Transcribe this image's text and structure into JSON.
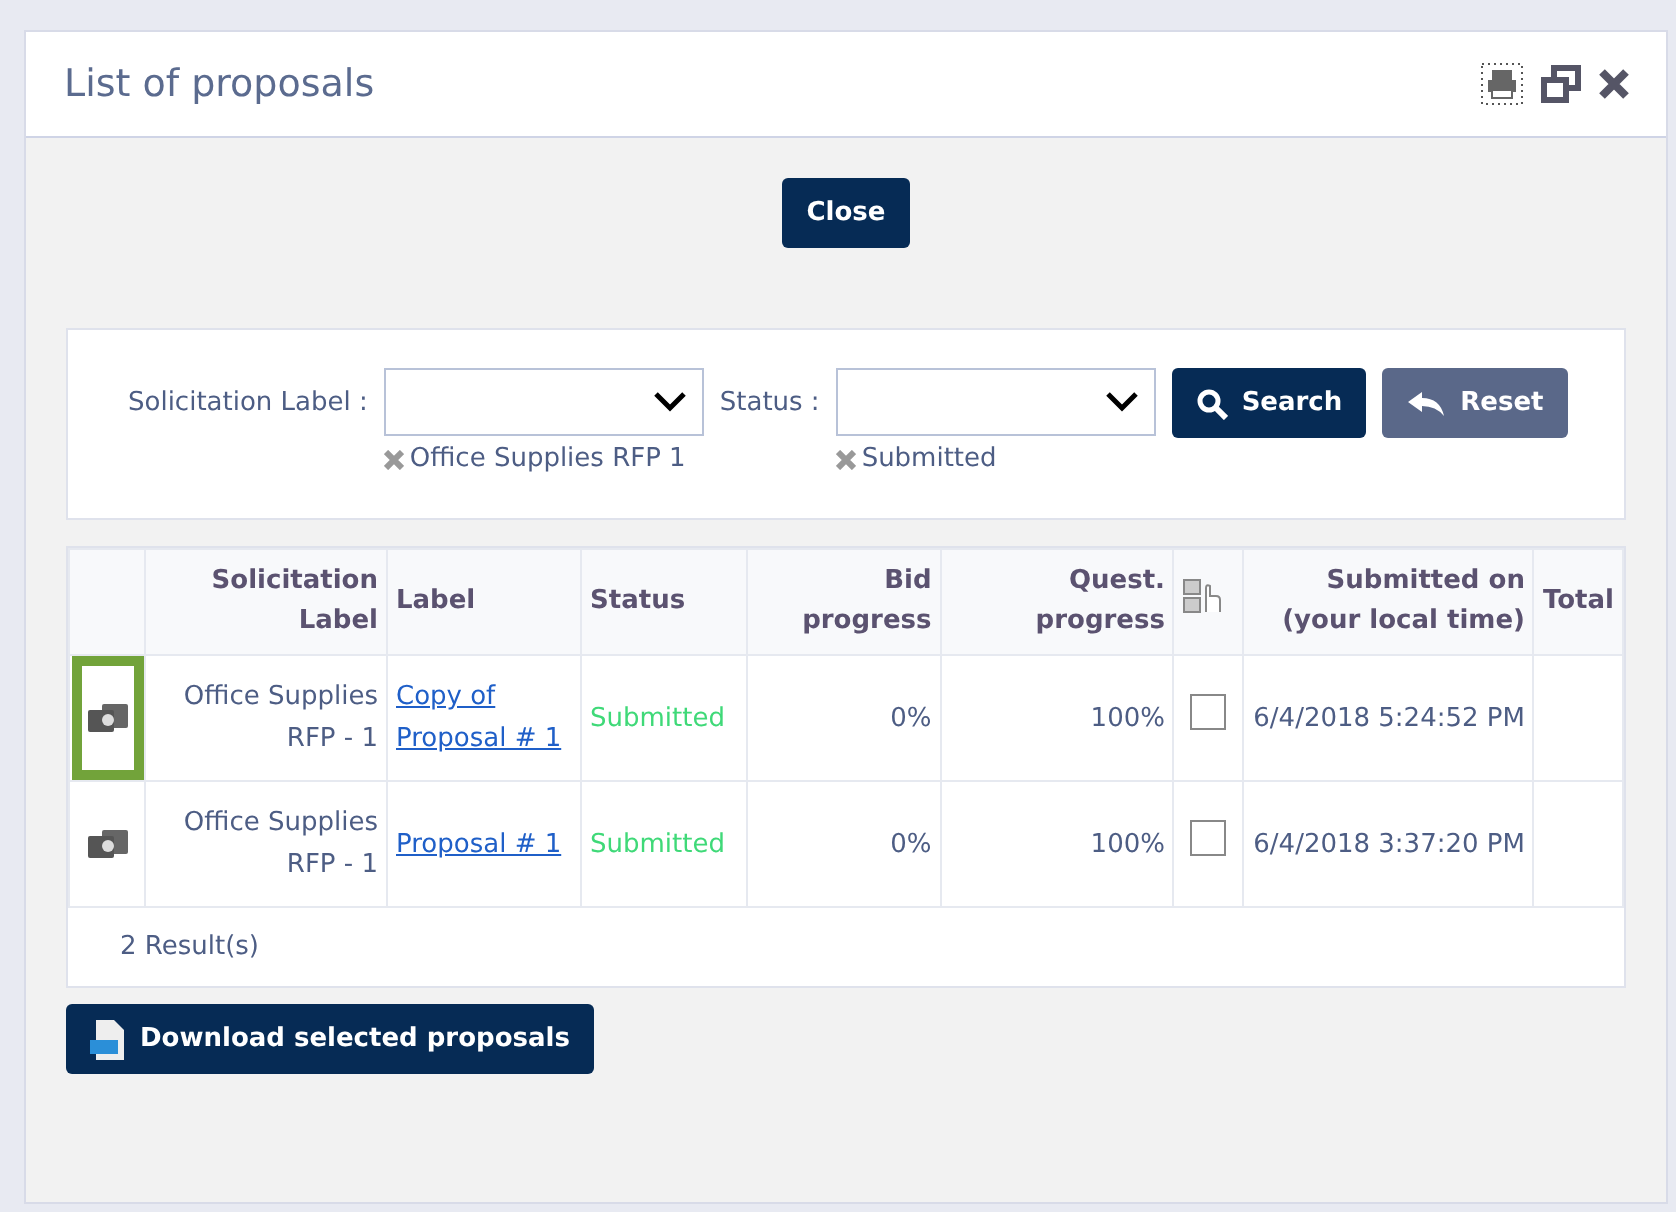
{
  "window": {
    "title": "List of proposals"
  },
  "close_button": "Close",
  "filters": [
    {
      "label": "Solicitation Label :",
      "chip": "Office Supplies RFP 1"
    },
    {
      "label": "Status :",
      "chip": "Submitted"
    }
  ],
  "search_button": "Search",
  "reset_button": "Reset",
  "table": {
    "columns": [
      "",
      "Solicitation Label",
      "Label",
      "Status",
      "Bid progress",
      "Quest. progress",
      "",
      "Submitted on (your local time)",
      "Total"
    ],
    "rows": [
      {
        "highlighted": true,
        "solicitation": "Office Supplies RFP - 1",
        "label": "Copy of Proposal # 1",
        "status": "Submitted",
        "bid": "0%",
        "quest": "100%",
        "checked": false,
        "submitted": "6/4/2018 5:24:52 PM"
      },
      {
        "highlighted": false,
        "solicitation": "Office Supplies RFP - 1",
        "label": "Proposal # 1",
        "status": "Submitted",
        "bid": "0%",
        "quest": "100%",
        "checked": false,
        "submitted": "6/4/2018 3:37:20 PM"
      }
    ],
    "results": "2 Result(s)"
  },
  "download_button": "Download selected proposals"
}
